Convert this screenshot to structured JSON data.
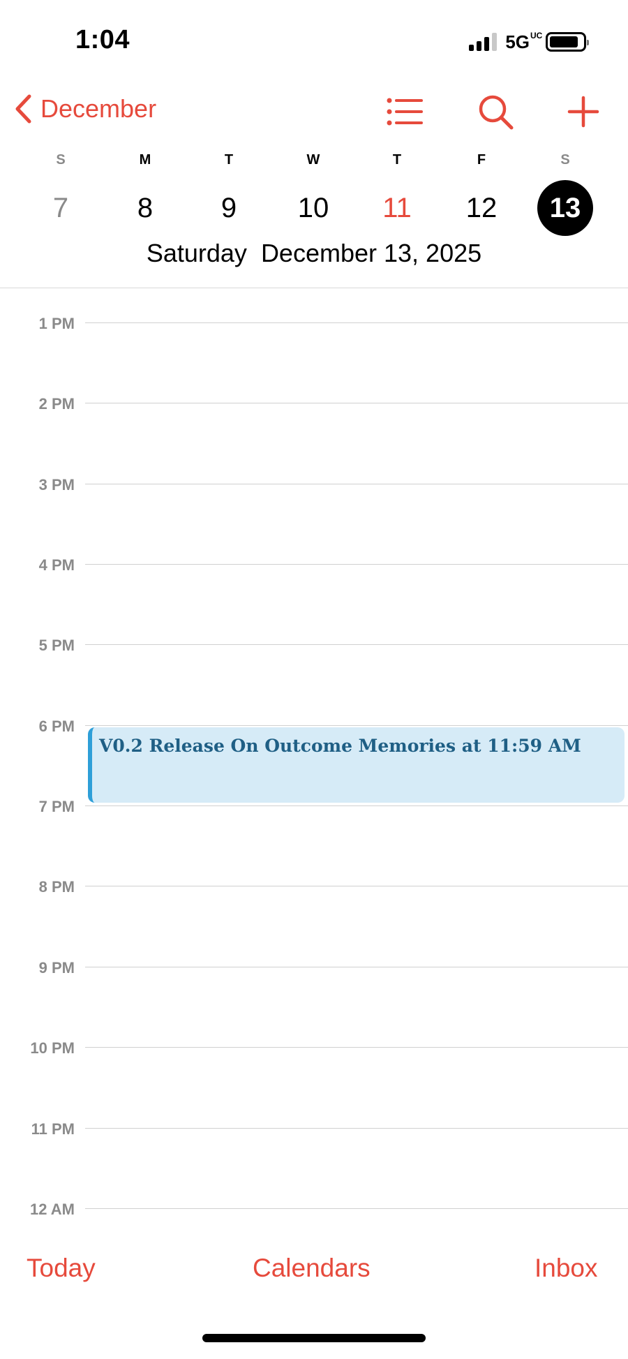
{
  "status_bar": {
    "time": "1:04",
    "network": "5G",
    "network_sup": "UC"
  },
  "nav": {
    "back_label": "December",
    "icons": [
      "chevron-left-icon",
      "list-icon",
      "search-icon",
      "plus-icon"
    ],
    "accent_color": "#e64a3c"
  },
  "week": {
    "days": [
      {
        "letter": "S",
        "date": "7"
      },
      {
        "letter": "M",
        "date": "8"
      },
      {
        "letter": "T",
        "date": "9"
      },
      {
        "letter": "W",
        "date": "10"
      },
      {
        "letter": "T",
        "date": "11"
      },
      {
        "letter": "F",
        "date": "12"
      },
      {
        "letter": "S",
        "date": "13"
      }
    ],
    "today_date": "11",
    "selected_date": "13"
  },
  "date_title": {
    "weekday": "Saturday",
    "full_date": "December 13, 2025"
  },
  "timeline": {
    "hours": [
      "1 PM",
      "2 PM",
      "3 PM",
      "4 PM",
      "5 PM",
      "6 PM",
      "7 PM",
      "8 PM",
      "9 PM",
      "10 PM",
      "11 PM",
      "12 AM"
    ]
  },
  "event": {
    "title": "V0.2 Release On Outcome Memories at 11:59 AM",
    "color": "#2e9fd8"
  },
  "tab_bar": {
    "today": "Today",
    "calendars": "Calendars",
    "inbox": "Inbox"
  }
}
